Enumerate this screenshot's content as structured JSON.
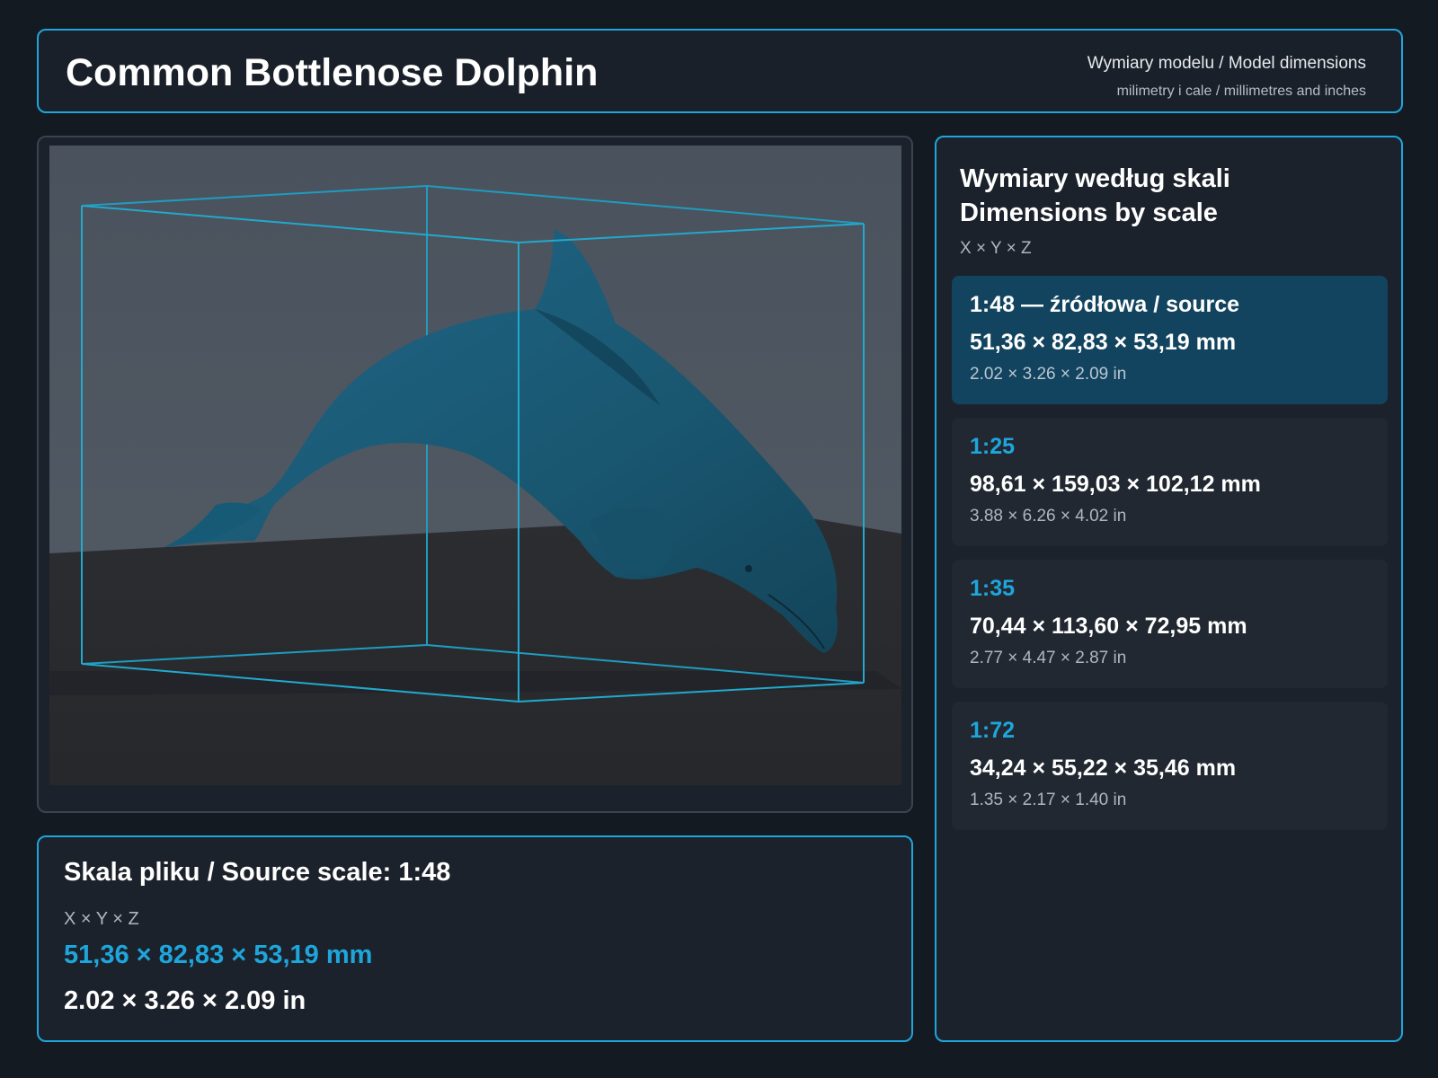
{
  "header": {
    "title": "Common Bottlenose Dolphin",
    "subtitle": "Wymiary modelu / Model dimensions",
    "units_note": "milimetry i cale / millimetres and inches"
  },
  "source_panel": {
    "title": "Skala pliku / Source scale: 1:48",
    "axis_label": "X × Y × Z",
    "dimensions_mm": "51,36 × 82,83 × 53,19 mm",
    "dimensions_in": "2.02 × 3.26 × 2.09 in"
  },
  "scales_panel": {
    "title_pl": "Wymiary według skali",
    "title_en": "Dimensions by scale",
    "axis_label": "X × Y × Z",
    "cards": [
      {
        "scale": "1:48  —  źródłowa / source",
        "mm": "51,36 × 82,83 × 53,19 mm",
        "inches": "2.02 × 3.26 × 2.09 in",
        "active": true
      },
      {
        "scale": "1:25",
        "mm": "98,61 × 159,03 × 102,12 mm",
        "inches": "3.88 × 6.26 × 4.02 in",
        "active": false
      },
      {
        "scale": "1:35",
        "mm": "70,44 × 113,60 × 72,95 mm",
        "inches": "2.77 × 4.47 × 2.87 in",
        "active": false
      },
      {
        "scale": "1:72",
        "mm": "34,24 × 55,22 × 35,46 mm",
        "inches": "1.35 × 2.17 × 1.40 in",
        "active": false
      }
    ]
  },
  "colors": {
    "accent": "#1ea6dc",
    "background": "#141a22",
    "panel": "#1c222b",
    "active_card": "#12445f",
    "dolphin": "#1b5670"
  }
}
